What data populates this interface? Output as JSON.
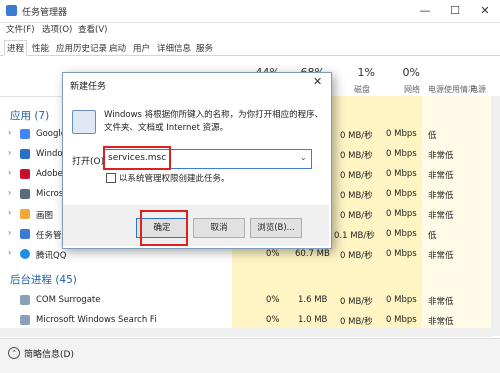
{
  "window": {
    "title": "任务管理器",
    "minimize": "—",
    "maximize": "☐",
    "close": "✕"
  },
  "menu": [
    "文件(F)",
    "选项(O)",
    "查看(V)"
  ],
  "tabs": [
    "进程",
    "性能",
    "应用历史记录",
    "启动",
    "用户",
    "详细信息",
    "服务"
  ],
  "columns": {
    "cpu_pct": "44%",
    "mem_pct": "68%",
    "disk_pct": "1%",
    "net_pct": "0%",
    "disk_label": "磁盘",
    "net_label": "网络",
    "power_label": "电源使用情况",
    "power_trend_label": "电源使用情况"
  },
  "sections": {
    "apps": "应用 (7)",
    "background": "后台进程 (45)"
  },
  "apps": [
    {
      "name": "Google",
      "disk": "0 MB/秒",
      "net": "0 Mbps",
      "power": "低",
      "color": "#4285f4"
    },
    {
      "name": "Window",
      "disk": "0 MB/秒",
      "net": "0 Mbps",
      "power": "非常低",
      "color": "#2b6fc9"
    },
    {
      "name": "Adobe",
      "disk": "0 MB/秒",
      "net": "0 Mbps",
      "power": "非常低",
      "color": "#c8102e"
    },
    {
      "name": "Micros",
      "disk": "0 MB/秒",
      "net": "0 Mbps",
      "power": "非常低",
      "color": "#5a6b7c"
    },
    {
      "name": "画图",
      "disk": "0 MB/秒",
      "net": "0 Mbps",
      "power": "非常低",
      "color": "#f2a93b"
    },
    {
      "name": "任务管",
      "disk": "0.1 MB/秒",
      "net": "0 Mbps",
      "power": "低",
      "color": "#3a7bd5"
    },
    {
      "name": "腾讯QQ",
      "cpu": "0%",
      "mem": "60.7 MB",
      "disk": "0 MB/秒",
      "net": "0 Mbps",
      "power": "非常低",
      "color": "#1a8fe3"
    }
  ],
  "background": [
    {
      "name": "COM Surrogate",
      "cpu": "0%",
      "mem": "1.6 MB",
      "disk": "0 MB/秒",
      "net": "0 Mbps",
      "power": "非常低"
    },
    {
      "name": "Microsoft Windows Search Fi",
      "cpu": "0%",
      "mem": "1.0 MB",
      "disk": "0 MB/秒",
      "net": "0 Mbps",
      "power": "非常低"
    }
  ],
  "footer": {
    "less_details": "简略信息(D)"
  },
  "dialog": {
    "title": "新建任务",
    "close": "✕",
    "line1": "Windows 将根据你所键入的名称，为你打开相应的程序、",
    "line2": "文件夹、文档或 Internet 资源。",
    "open_label": "打开(O):",
    "open_value": "services.msc",
    "admin_label": "以系统管理权限创建此任务。",
    "ok": "确定",
    "cancel": "取消",
    "browse": "浏览(B)..."
  }
}
